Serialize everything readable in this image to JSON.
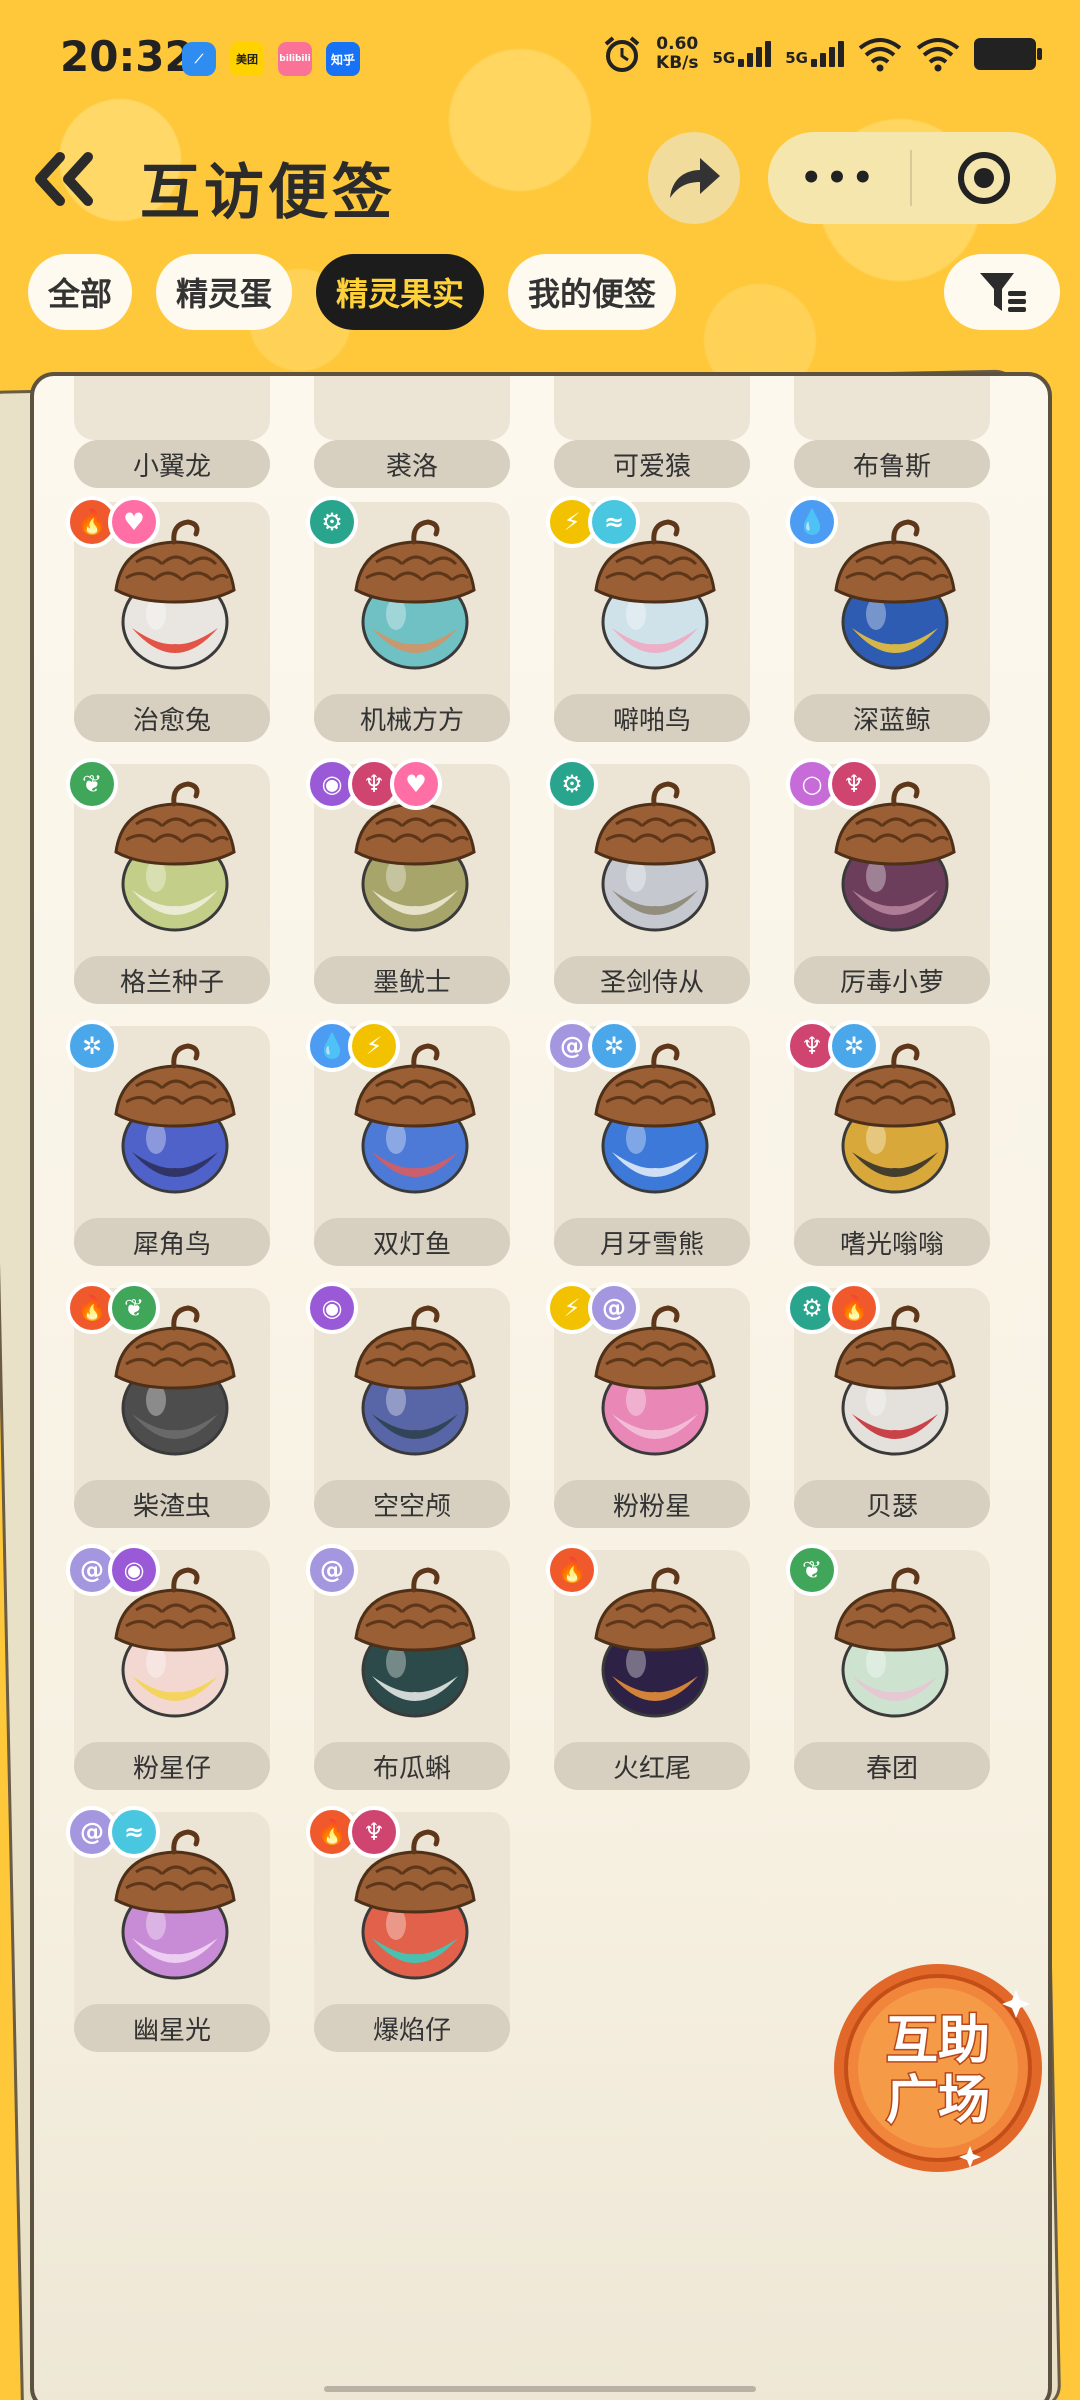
{
  "status_bar": {
    "time": "20:32",
    "apps": [
      "美团",
      "bilibili",
      "知乎"
    ],
    "speed_value": "0.60",
    "speed_unit": "KB/s",
    "net1": "5G",
    "net2": "5G"
  },
  "header": {
    "title": "互访便签",
    "back_icon": "double-chevron-left-icon",
    "more_label": "•••"
  },
  "tabs": [
    {
      "label": "全部",
      "active": false
    },
    {
      "label": "精灵蛋",
      "active": false
    },
    {
      "label": "精灵果实",
      "active": true
    },
    {
      "label": "我的便签",
      "active": false
    }
  ],
  "fruits": [
    {
      "name": "小翼龙",
      "badges": []
    },
    {
      "name": "裘洛",
      "badges": []
    },
    {
      "name": "可爱猿",
      "badges": []
    },
    {
      "name": "布鲁斯",
      "badges": []
    },
    {
      "name": "治愈兔",
      "badges": [
        "fire",
        "heart"
      ],
      "color": "#e9e6e2",
      "accent": "#e23a2a"
    },
    {
      "name": "机械方方",
      "badges": [
        "gear"
      ],
      "color": "#6fc1c4",
      "accent": "#d9915f"
    },
    {
      "name": "噼啪鸟",
      "badges": [
        "bolt",
        "wing"
      ],
      "color": "#cfe2ea",
      "accent": "#f2a6c0"
    },
    {
      "name": "深蓝鲸",
      "badges": [
        "water"
      ],
      "color": "#2f5cb3",
      "accent": "#f3c534"
    },
    {
      "name": "格兰种子",
      "badges": [
        "leaf"
      ],
      "color": "#c3cf88",
      "accent": "#f2f0e2"
    },
    {
      "name": "墨鱿士",
      "badges": [
        "ghost",
        "devil",
        "heart"
      ],
      "color": "#a8a56a",
      "accent": "#f1ecda"
    },
    {
      "name": "圣剑侍从",
      "badges": [
        "gear"
      ],
      "color": "#c5c9cf",
      "accent": "#8a8270"
    },
    {
      "name": "厉毒小萝",
      "badges": [
        "bubble",
        "devil"
      ],
      "color": "#6c3e5c",
      "accent": "#b8879f"
    },
    {
      "name": "犀角鸟",
      "badges": [
        "ice"
      ],
      "color": "#4f62c9",
      "accent": "#2a2d55"
    },
    {
      "name": "双灯鱼",
      "badges": [
        "water",
        "bolt"
      ],
      "color": "#4d7ad6",
      "accent": "#e05b5b"
    },
    {
      "name": "月牙雪熊",
      "badges": [
        "swirl",
        "ice"
      ],
      "color": "#3c79d8",
      "accent": "#e9f2fb"
    },
    {
      "name": "嗜光嗡嗡",
      "badges": [
        "devil",
        "ice"
      ],
      "color": "#d8a93a",
      "accent": "#2c2c2c"
    },
    {
      "name": "柴渣虫",
      "badges": [
        "fire",
        "leaf"
      ],
      "color": "#4d4d4d",
      "accent": "#6e6e6e"
    },
    {
      "name": "空空颅",
      "badges": [
        "ghost"
      ],
      "color": "#5866a8",
      "accent": "#2c3f4a"
    },
    {
      "name": "粉粉星",
      "badges": [
        "bolt",
        "swirl"
      ],
      "color": "#e987b7",
      "accent": "#f5c6dc"
    },
    {
      "name": "贝瑟",
      "badges": [
        "gear",
        "fire"
      ],
      "color": "#e4e1dc",
      "accent": "#c3262e"
    },
    {
      "name": "粉星仔",
      "badges": [
        "swirl",
        "ghost"
      ],
      "color": "#f2d8d0",
      "accent": "#f5d34a"
    },
    {
      "name": "布瓜蝌",
      "badges": [
        "swirl"
      ],
      "color": "#2d4a4a",
      "accent": "#eef0ec"
    },
    {
      "name": "火红尾",
      "badges": [
        "fire"
      ],
      "color": "#2d2246",
      "accent": "#f09437"
    },
    {
      "name": "春团",
      "badges": [
        "leaf"
      ],
      "color": "#cde3cf",
      "accent": "#e9c3d2"
    },
    {
      "name": "幽星光",
      "badges": [
        "swirl",
        "wing"
      ],
      "color": "#c88bd6",
      "accent": "#f3d8f6"
    },
    {
      "name": "爆焰仔",
      "badges": [
        "fire",
        "devil"
      ],
      "color": "#e2614a",
      "accent": "#2fd2c2"
    }
  ],
  "help_plaza": {
    "line1": "互助",
    "line2": "广场"
  }
}
